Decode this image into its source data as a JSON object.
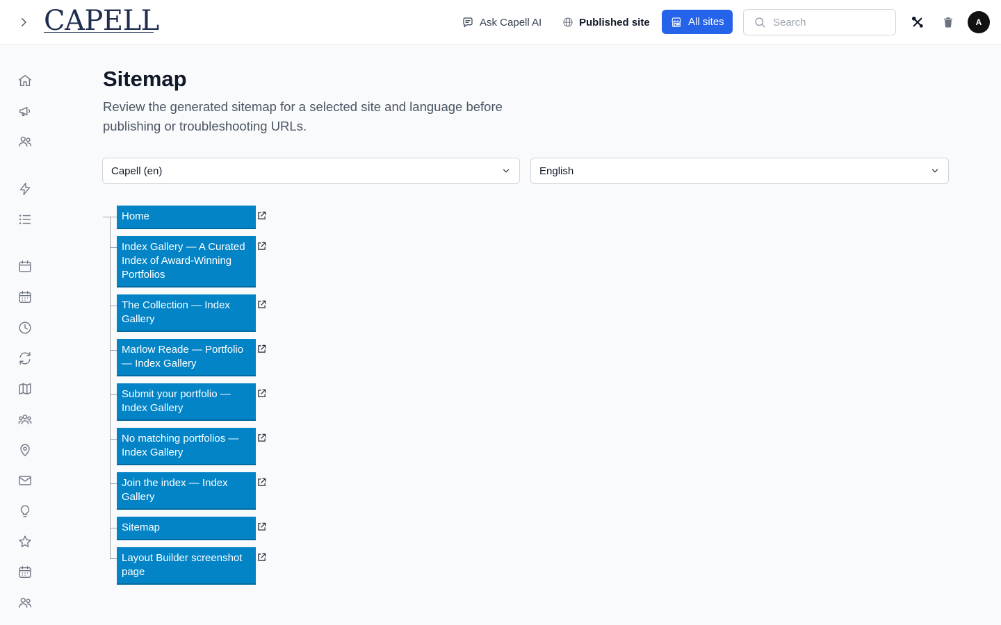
{
  "header": {
    "logo_text": "CAPELL",
    "ask_ai_label": "Ask Capell AI",
    "published_site_label": "Published site",
    "all_sites_label": "All sites",
    "search_placeholder": "Search",
    "avatar_initial": "A",
    "accent_color": "#2563eb"
  },
  "sidebar": {
    "icons": [
      "home-icon",
      "megaphone-icon",
      "users-icon",
      "bolt-icon",
      "list-icon",
      "calendar-icon",
      "calendar-days-icon",
      "clock-icon",
      "refresh-icon",
      "map-icon",
      "user-group-icon",
      "map-pin-icon",
      "mail-icon",
      "lightbulb-icon",
      "star-icon",
      "calendar-days-icon",
      "users-icon"
    ]
  },
  "main": {
    "title": "Sitemap",
    "description": "Review the generated sitemap for a selected site and language before publishing or troubleshooting URLs.",
    "site_select": {
      "value": "Capell (en)"
    },
    "language_select": {
      "value": "English"
    }
  },
  "tree": {
    "node_color": "#0284c7",
    "nodes": [
      {
        "label": "Home"
      },
      {
        "label": "Index Gallery — A Curated Index of Award-Winning Portfolios"
      },
      {
        "label": "The Collection — Index Gallery"
      },
      {
        "label": "Marlow Reade — Portfolio — Index Gallery"
      },
      {
        "label": "Submit your portfolio — Index Gallery"
      },
      {
        "label": "No matching portfolios — Index Gallery"
      },
      {
        "label": "Join the index — Index Gallery"
      },
      {
        "label": "Sitemap"
      },
      {
        "label": "Layout Builder screenshot page"
      }
    ]
  }
}
